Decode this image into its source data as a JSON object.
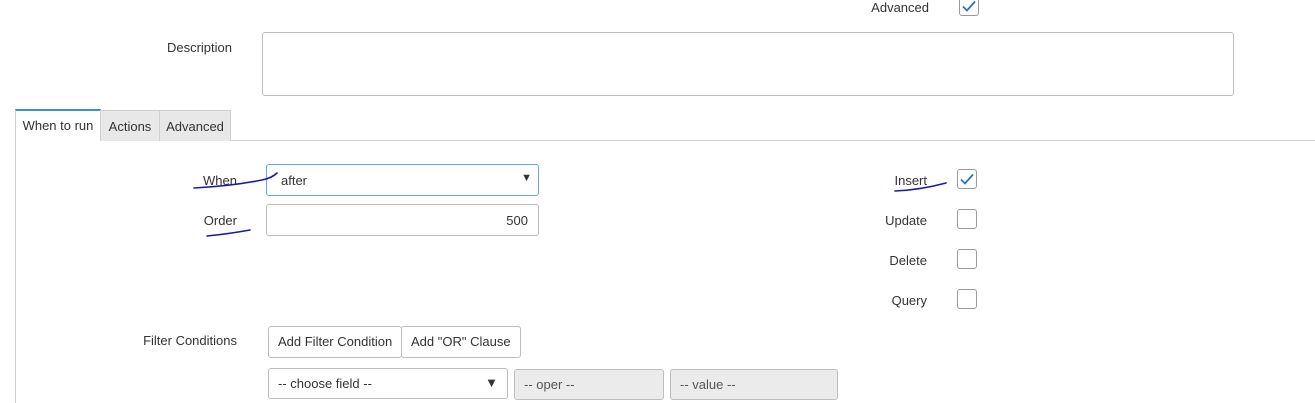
{
  "top": {
    "advanced_label": "Advanced",
    "advanced_checked": true,
    "description_label": "Description",
    "description_value": ""
  },
  "tabs": [
    {
      "label": "When to run",
      "active": true
    },
    {
      "label": "Actions",
      "active": false
    },
    {
      "label": "Advanced",
      "active": false
    }
  ],
  "form": {
    "when_label": "When",
    "when_value": "after",
    "order_label": "Order",
    "order_value": "500",
    "insert_label": "Insert",
    "insert_checked": true,
    "update_label": "Update",
    "update_checked": false,
    "delete_label": "Delete",
    "delete_checked": false,
    "query_label": "Query",
    "query_checked": false
  },
  "filter": {
    "label": "Filter Conditions",
    "add_condition_label": "Add Filter Condition",
    "add_or_label": "Add \"OR\" Clause",
    "field_placeholder": "-- choose field --",
    "oper_placeholder": "-- oper --",
    "value_placeholder": "-- value --"
  },
  "colors": {
    "accent": "#3b8ed6",
    "checkmark": "#2e6fbf",
    "annotation_ink": "#1a1aa6"
  }
}
